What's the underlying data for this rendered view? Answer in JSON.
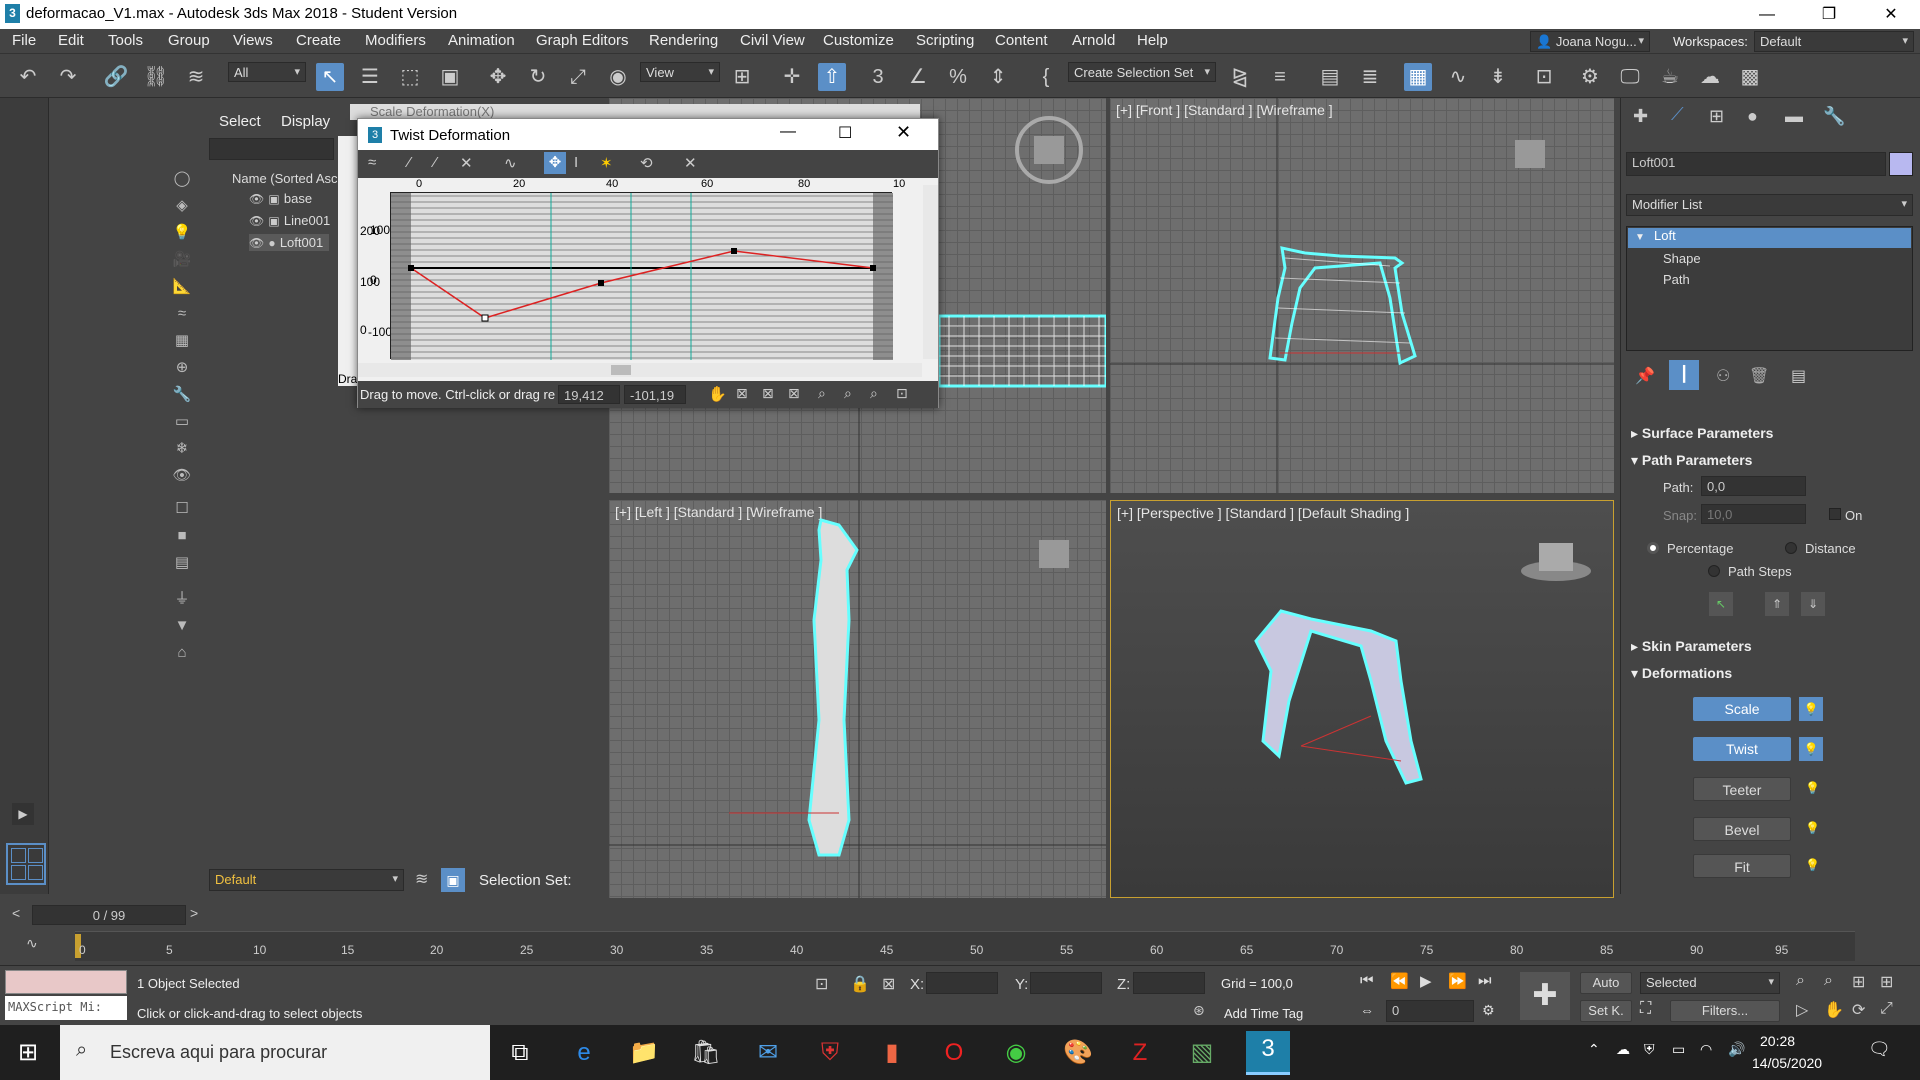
{
  "window": {
    "title": "deformacao_V1.max - Autodesk 3ds Max 2018 - Student Version"
  },
  "menu": [
    "File",
    "Edit",
    "Tools",
    "Group",
    "Views",
    "Create",
    "Modifiers",
    "Animation",
    "Graph Editors",
    "Rendering",
    "Civil View",
    "Customize",
    "Scripting",
    "Content",
    "Arnold",
    "Help"
  ],
  "user": "Joana Nogu...",
  "workspaces": {
    "label": "Workspaces:",
    "value": "Default"
  },
  "toolbar": {
    "filter": "All",
    "view": "View",
    "selection_set": "Create Selection Set"
  },
  "scene": {
    "tabs": [
      "Select",
      "Display"
    ],
    "column_header": "Name (Sorted Asc",
    "items": [
      "base",
      "Line001",
      "Loft001"
    ],
    "layer": "Default",
    "selection_set_label": "Selection Set:"
  },
  "dialog_behind": {
    "title": "Scale Deformation(X)"
  },
  "dialog": {
    "title": "Twist Deformation",
    "ruler": [
      "0",
      "20",
      "40",
      "60",
      "80",
      "10"
    ],
    "yaxis": [
      "200",
      "100",
      "0",
      "100",
      "0",
      "-100"
    ],
    "status": "Drag to move. Ctrl-click or drag re",
    "x_value": "19,412",
    "y_value": "-101,19",
    "hidden_label": "Dra"
  },
  "viewports": {
    "front": "[+] [Front ] [Standard ] [Wireframe ]",
    "left": "[+] [Left ] [Standard ] [Wireframe ]",
    "perspective": "[+] [Perspective ] [Standard ] [Default Shading ]"
  },
  "command_panel": {
    "object_name": "Loft001",
    "modifier_list": "Modifier List",
    "stack": [
      "Loft",
      "Shape",
      "Path"
    ],
    "surface_parameters": "Surface Parameters",
    "path_parameters": "Path Parameters",
    "path_label": "Path:",
    "path_value": "0,0",
    "snap_label": "Snap:",
    "snap_value": "10,0",
    "on_label": "On",
    "percentage": "Percentage",
    "distance": "Distance",
    "path_steps": "Path Steps",
    "skin_parameters": "Skin Parameters",
    "deformations": "Deformations",
    "deform_buttons": [
      "Scale",
      "Twist",
      "Teeter",
      "Bevel",
      "Fit"
    ]
  },
  "timeline": {
    "frame_display": "0 / 99",
    "ticks": [
      "0",
      "5",
      "10",
      "15",
      "20",
      "25",
      "30",
      "35",
      "40",
      "45",
      "50",
      "55",
      "60",
      "65",
      "70",
      "75",
      "80",
      "85",
      "90",
      "95"
    ]
  },
  "status": {
    "maxscript": "MAXScript Mi:",
    "selected": "1 Object Selected",
    "prompt": "Click or click-and-drag to select objects",
    "x_label": "X:",
    "y_label": "Y:",
    "z_label": "Z:",
    "grid": "Grid = 100,0",
    "add_time_tag": "Add Time Tag",
    "auto": "Auto",
    "set_key": "Set K.",
    "key_mode": "Selected",
    "filters": "Filters...",
    "frame": "0"
  },
  "taskbar": {
    "search_placeholder": "Escreva aqui para procurar",
    "time": "20:28",
    "date": "14/05/2020"
  }
}
